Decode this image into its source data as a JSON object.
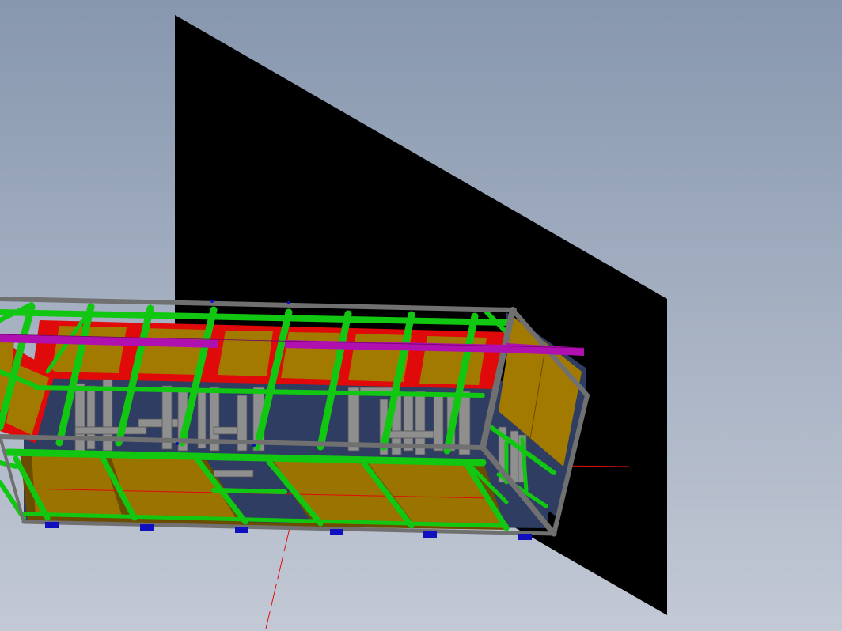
{
  "viewport": {
    "background_top": "#8797ae",
    "background_bottom": "#c3c9d5",
    "colors": {
      "reference_plane": "#000000",
      "frame_green": "#12c712",
      "frame_green_dark": "#0b8f0b",
      "frame_red": "#e00a0a",
      "panel_gold": "#a37a00",
      "panel_brown": "#6b4d00",
      "panel_navy": "#2f3d63",
      "steel_gray": "#8f8f8f",
      "steel_gray_dark": "#555555",
      "beam_magenta": "#b010b0",
      "axis_red": "#e01010",
      "foot_blue": "#1010c0"
    }
  }
}
